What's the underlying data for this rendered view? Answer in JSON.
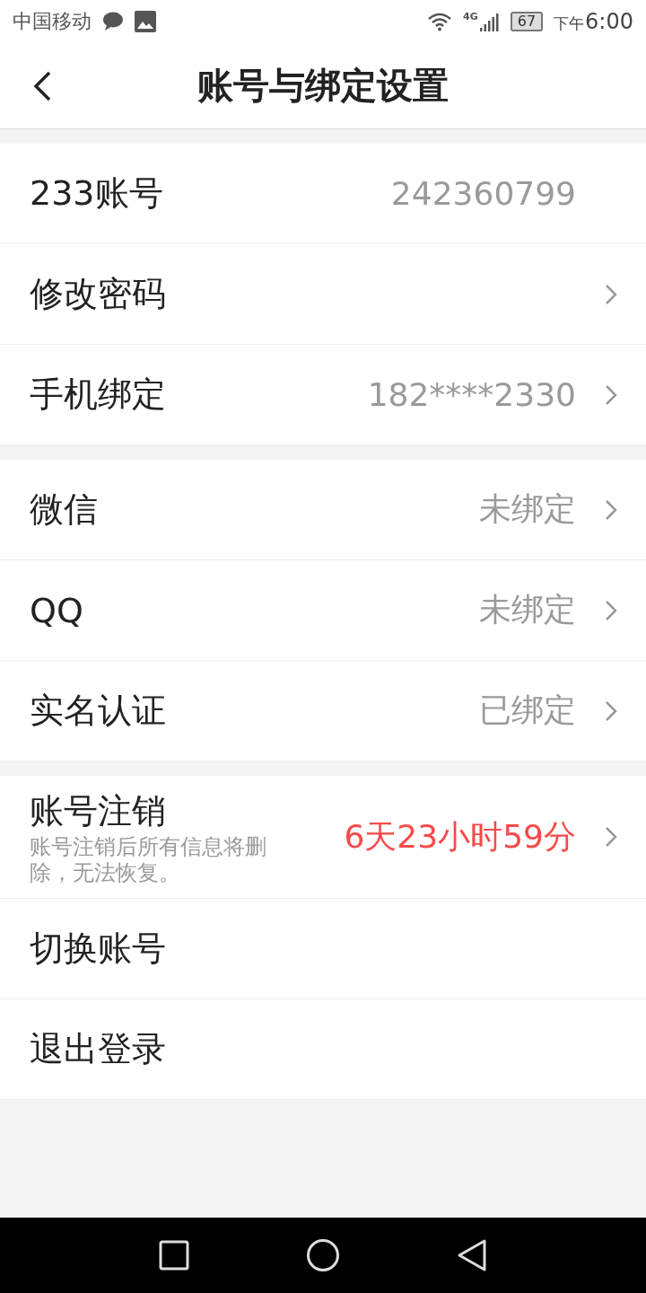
{
  "status_bar": {
    "carrier": "中国移动",
    "network": "4G",
    "battery": "67",
    "period": "下午",
    "time": "6:00"
  },
  "header": {
    "title": "账号与绑定设置"
  },
  "groups": [
    {
      "rows": [
        {
          "kind": "plain",
          "label": "233账号",
          "value": "242360799",
          "arrow": false
        },
        {
          "kind": "plain",
          "label": "修改密码",
          "arrow": true
        },
        {
          "kind": "plain",
          "label": "手机绑定",
          "value": "182****2330",
          "arrow": true
        }
      ]
    },
    {
      "rows": [
        {
          "kind": "plain",
          "label": "微信",
          "value": "未绑定",
          "arrow": true
        },
        {
          "kind": "plain",
          "label": "QQ",
          "value": "未绑定",
          "arrow": true
        },
        {
          "kind": "plain",
          "label": "实名认证",
          "value": "已绑定",
          "arrow": true
        }
      ]
    },
    {
      "rows": [
        {
          "kind": "countdown",
          "label": "账号注销",
          "note": "账号注销后所有信息将删除，无法恢复。",
          "value": "6天23小时59分",
          "arrow": true
        },
        {
          "kind": "plain",
          "label": "切换账号",
          "arrow": false
        },
        {
          "kind": "plain",
          "label": "退出登录",
          "arrow": false
        }
      ]
    }
  ]
}
